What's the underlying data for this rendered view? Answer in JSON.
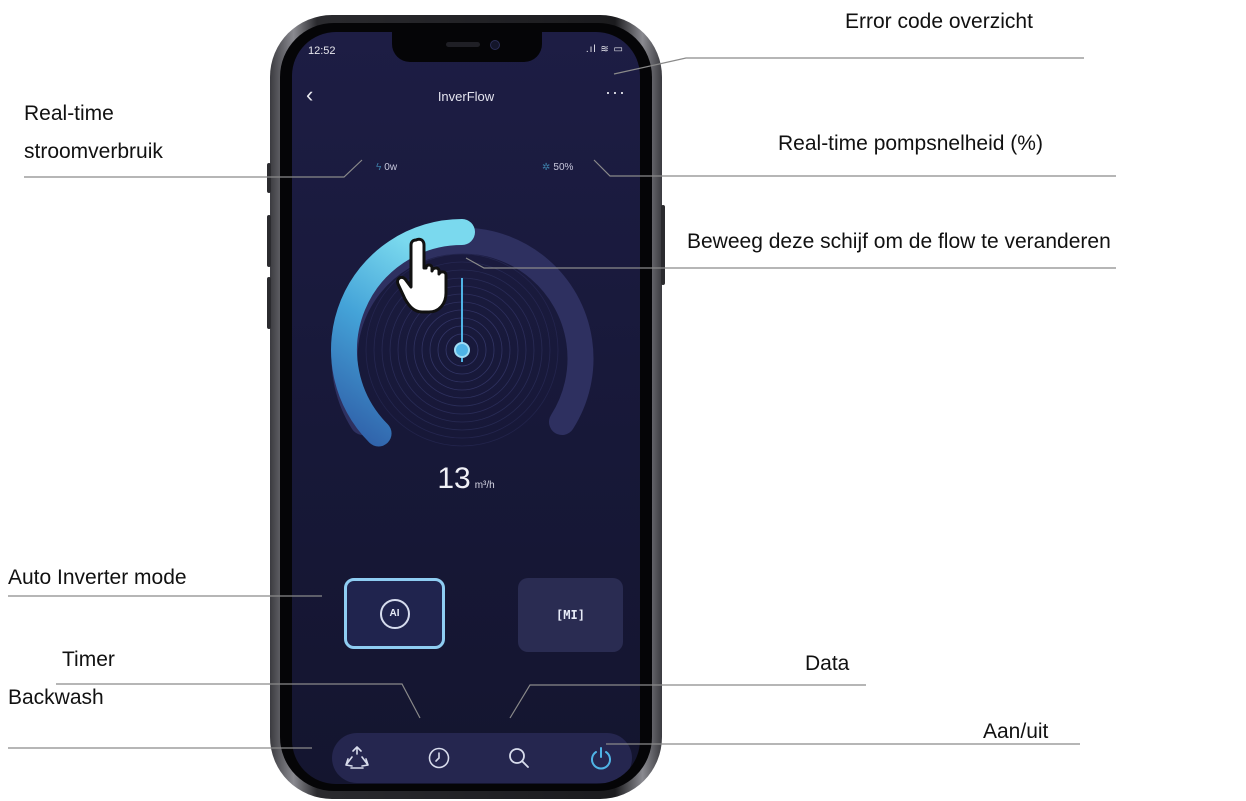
{
  "annotations": {
    "error_code": "Error code overzicht",
    "power_usage_line1": "Real-time",
    "power_usage_line2": "stroomverbruik",
    "pump_speed": "Real-time pompsnelheid (%)",
    "dial_hint": "Beweeg deze schijf om de flow te veranderen",
    "auto_inverter": "Auto Inverter mode",
    "timer": "Timer",
    "data": "Data",
    "backwash": "Backwash",
    "power": "Aan/uit"
  },
  "status_bar": {
    "time": "12:52",
    "icons": ".ıl ≋ ▭"
  },
  "app": {
    "title": "InverFlow",
    "back_icon": "‹",
    "more_icon": "···",
    "power_value": "0w",
    "pump_speed_value": "50%",
    "flow_value": "13",
    "flow_unit": "m³/h",
    "dial_level_percent": 50
  },
  "modes": {
    "ai_label": "AI",
    "mi_label": "[MI]",
    "selected": "ai"
  },
  "colors": {
    "accent": "#4fb4e6",
    "background": "#1b1c42",
    "ai_border": "#8fcdf2"
  },
  "nav_icons": [
    "backwash-icon",
    "timer-icon",
    "search-icon",
    "power-icon"
  ]
}
